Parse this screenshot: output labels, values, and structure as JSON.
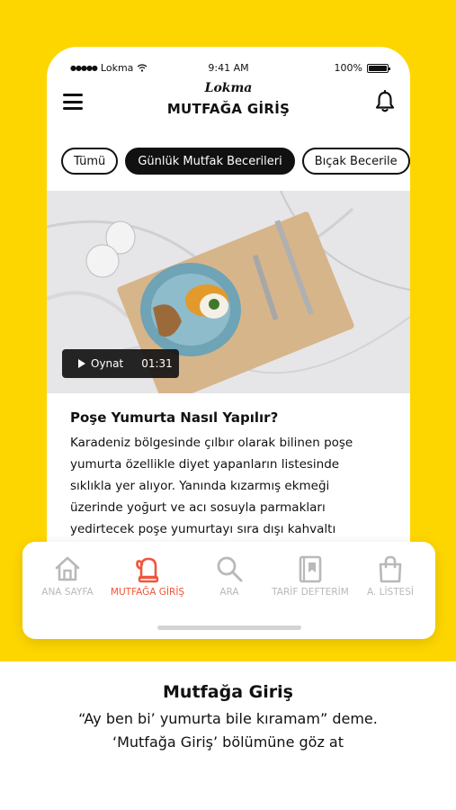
{
  "status_bar": {
    "carrier": "Lokma",
    "time": "9:41 AM",
    "battery": "100%"
  },
  "header": {
    "brand": "Lokma",
    "title": "MUTFAĞA GİRİŞ"
  },
  "chips": [
    {
      "label": "Tümü",
      "active": false
    },
    {
      "label": "Günlük Mutfak Becerileri",
      "active": true
    },
    {
      "label": "Bıçak Becerile",
      "active": false
    }
  ],
  "video": {
    "play_label": "Oynat",
    "duration": "01:31"
  },
  "article": {
    "title": "Poşe Yumurta Nasıl Yapılır?",
    "lines": [
      "Karadeniz bölgesinde çılbır olarak bilinen poşe",
      "yumurta özellikle diyet yapanların listesinde",
      "sıklıkla yer alıyor. Yanında kızarmış ekmeği",
      "üzerinde yoğurt ve acı sosuyla parmakları",
      "yedirtecek poşe yumurtayı sıra dışı kahvaltı"
    ]
  },
  "tabs": [
    {
      "label": "ANA SAYFA",
      "icon": "home-icon",
      "active": false
    },
    {
      "label": "MUTFAĞA GİRİŞ",
      "icon": "oven-mitt-icon",
      "active": true
    },
    {
      "label": "ARA",
      "icon": "search-icon",
      "active": false
    },
    {
      "label": "TARİF DEFTERİM",
      "icon": "bookmark-book-icon",
      "active": false
    },
    {
      "label": "A. LİSTESİ",
      "icon": "shopping-bag-icon",
      "active": false
    }
  ],
  "caption": {
    "title": "Mutfağa Giriş",
    "line1": "“Ay ben bi’ yumurta bile kıramam” deme.",
    "line2": "‘Mutfağa Giriş’ bölümüne göz at"
  },
  "colors": {
    "background": "#FDD600",
    "accent": "#F0553A",
    "inactive": "#B9B9B9",
    "text": "#111111"
  }
}
